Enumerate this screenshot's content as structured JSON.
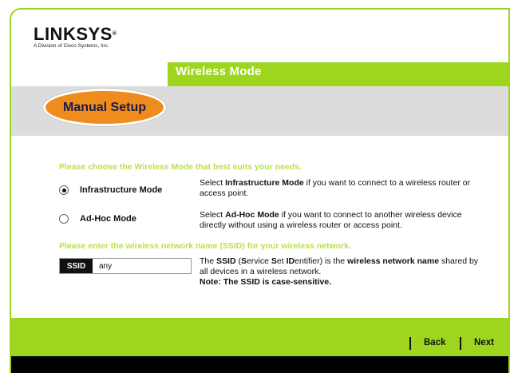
{
  "brand": {
    "logo_text": "LINKSYS",
    "logo_mark": "®",
    "tagline": "A Division of Cisco Systems, Inc."
  },
  "header": {
    "title": "Wireless Mode",
    "step_label": "Manual Setup"
  },
  "mode_section": {
    "prompt": "Please choose the Wireless Mode that best suits your needs.",
    "options": [
      {
        "label": "Infrastructure Mode",
        "selected": true,
        "desc_pre": "Select ",
        "desc_bold": "Infrastructure Mode",
        "desc_post": " if you want to connect to a wireless router or access point."
      },
      {
        "label": "Ad-Hoc Mode",
        "selected": false,
        "desc_pre": "Select ",
        "desc_bold": "Ad-Hoc Mode",
        "desc_post": " if you want to connect to another wireless device directly without using a wireless router or access point."
      }
    ]
  },
  "ssid_section": {
    "prompt": "Please enter the wireless network name (SSID) for your wireless network.",
    "field_label": "SSID",
    "field_value": "any",
    "desc_the": "The ",
    "desc_ssid": "SSID",
    "desc_paren_open": " (",
    "desc_s": "S",
    "desc_ervice": "ervice ",
    "desc_s2": "S",
    "desc_et": "et ",
    "desc_id": "ID",
    "desc_entifier": "entifier) is the ",
    "desc_wnn": "wireless network name",
    "desc_shared": " shared by all devices in a wireless network.",
    "note": "Note: The SSID is case-sensitive."
  },
  "footer": {
    "back_label": "Back",
    "next_label": "Next"
  },
  "colors": {
    "accent_green": "#9ed61f",
    "prompt_green": "#b9e245",
    "orange": "#f08c1e",
    "gray_band": "#dcdcdc"
  }
}
